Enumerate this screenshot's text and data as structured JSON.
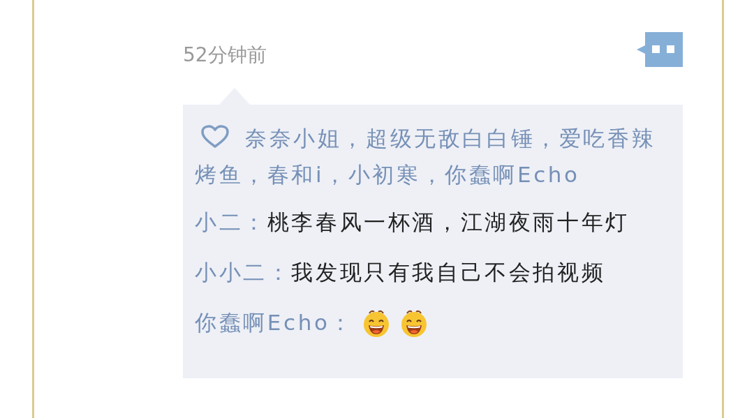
{
  "post": {
    "time": "52分钟前"
  },
  "likes": {
    "names": "奈奈小姐，超级无敌白白锤，爱吃香辣烤鱼，春和i，小初寒，你蠢啊Echo"
  },
  "comments": [
    {
      "author": "小二：",
      "parts": [
        {
          "kind": "text",
          "text": "桃李春风一杯酒，江湖夜雨十年灯"
        }
      ]
    },
    {
      "author": "小小二：",
      "parts": [
        {
          "kind": "text",
          "text": "我发现只有我自己不会拍视频"
        }
      ]
    },
    {
      "author": "你蠢啊Echo：",
      "parts": [
        {
          "kind": "emoji"
        },
        {
          "kind": "emoji"
        }
      ]
    }
  ]
}
